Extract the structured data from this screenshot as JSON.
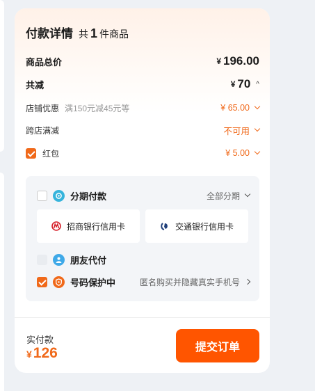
{
  "header": {
    "title": "付款详情",
    "count_prefix": "共",
    "count_value": "1",
    "count_suffix": "件商品"
  },
  "summary": {
    "total_label": "商品总价",
    "total_currency": "¥",
    "total_value": "196.00",
    "reduce_label": "共减",
    "reduce_currency": "¥",
    "reduce_value": "70"
  },
  "discounts": {
    "shop_label": "店铺优惠",
    "shop_note": "满150元减45元等",
    "shop_value": "¥ 65.00",
    "cross_label": "跨店满减",
    "cross_value": "不可用",
    "redpacket_label": "红包",
    "redpacket_value": "¥ 5.00",
    "redpacket_checked": true
  },
  "payment": {
    "installment_label": "分期付款",
    "installment_option": "全部分期",
    "installment_checked": false,
    "banks": [
      "招商银行信用卡",
      "交通银行信用卡"
    ],
    "friend_label": "朋友代付",
    "friend_enabled": false,
    "protect_label": "号码保护中",
    "protect_desc": "匿名购买并隐藏真实手机号",
    "protect_checked": true
  },
  "footer": {
    "paid_label": "实付款",
    "paid_currency": "¥",
    "paid_value": "126",
    "submit_label": "提交订单"
  },
  "colors": {
    "accent": "#f0691a",
    "button": "#ff5500",
    "installment_icon": "#36b4dc",
    "friend_icon": "#3fa9e8",
    "protect_icon": "#f0691a",
    "cmb_logo": "#d6202a",
    "bocom_logo": "#1f3f7a"
  },
  "icons": {
    "installment": "installment-icon",
    "friend": "friend-pay-icon",
    "protect": "shield-icon",
    "cmb": "cmb-logo-icon",
    "bocom": "bocom-logo-icon"
  }
}
